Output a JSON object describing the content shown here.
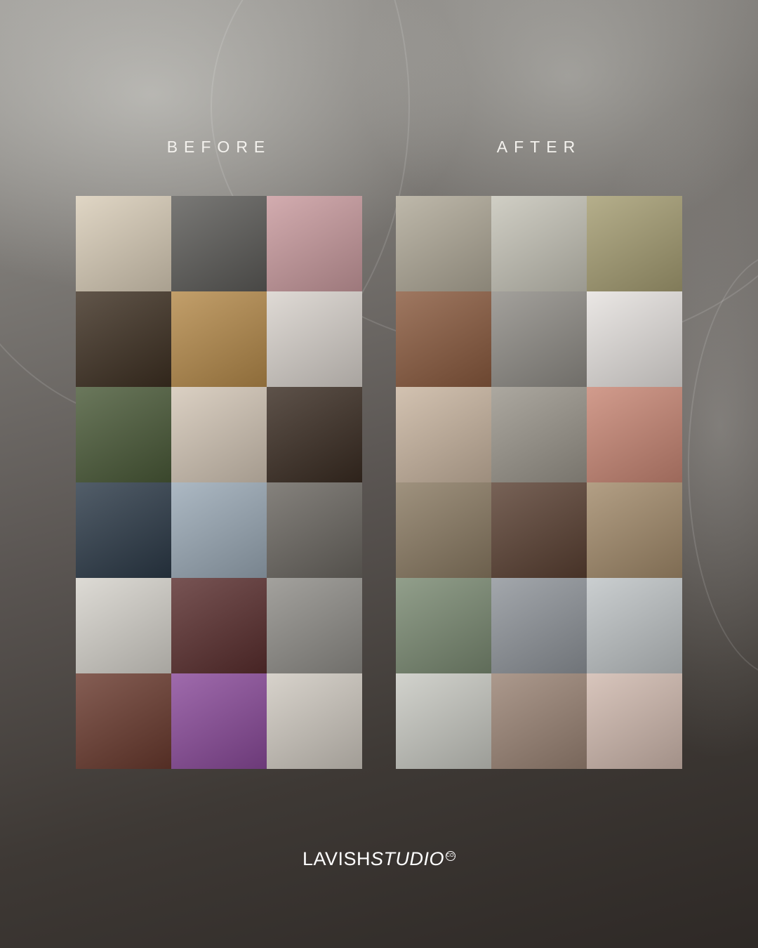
{
  "headings": {
    "before": "BEFORE",
    "after": "AFTER"
  },
  "brand": {
    "part1": "LAVISH",
    "part2": "STUDIO",
    "mark": "CO."
  },
  "before_tiles": [
    {
      "name": "rings-on-lace-photo",
      "color": "#d9cdb8"
    },
    {
      "name": "couple-shadow-photo",
      "color": "#5c5b58"
    },
    {
      "name": "floral-cake-photo",
      "color": "#c99a9e"
    },
    {
      "name": "tiered-cake-night-photo",
      "color": "#3e3022"
    },
    {
      "name": "golden-ballroom-photo",
      "color": "#b58a4a"
    },
    {
      "name": "bouquet-invitation-photo",
      "color": "#d8d2cc"
    },
    {
      "name": "holding-hands-photo",
      "color": "#4a5a38"
    },
    {
      "name": "bride-groom-hearts-photo",
      "color": "#d3c6b6"
    },
    {
      "name": "string-lights-dance-photo",
      "color": "#3a2c22"
    },
    {
      "name": "wedding-car-photo",
      "color": "#2c3a48"
    },
    {
      "name": "lakeside-aisle-photo",
      "color": "#9aa9b6"
    },
    {
      "name": "stairs-couple-photo",
      "color": "#6a6660"
    },
    {
      "name": "arch-ceremony-photo",
      "color": "#d6d3cc"
    },
    {
      "name": "dancing-couple-photo",
      "color": "#5a2e2e"
    },
    {
      "name": "invitation-card-photo",
      "color": "#8f8d88"
    },
    {
      "name": "cake-flowers-photo",
      "color": "#6a3a2e"
    },
    {
      "name": "purple-dance-floor-photo",
      "color": "#8a4a9a"
    },
    {
      "name": "bokeh-rings-photo",
      "color": "#cfc9c0"
    }
  ],
  "after_tiles": [
    {
      "name": "candle-table-photo",
      "color": "#b0a998"
    },
    {
      "name": "vintage-car-couple-photo",
      "color": "#c6c4b8"
    },
    {
      "name": "greenery-initial-photo",
      "color": "#a59d72"
    },
    {
      "name": "dried-flower-cake-photo",
      "color": "#8a5a3e"
    },
    {
      "name": "groom-carrying-bride-photo",
      "color": "#8f8c86"
    },
    {
      "name": "cherry-glasses-photo",
      "color": "#e6e2df"
    },
    {
      "name": "napkin-place-setting-photo",
      "color": "#c9b5a0"
    },
    {
      "name": "running-couple-photo",
      "color": "#9a958b"
    },
    {
      "name": "peach-roses-photo",
      "color": "#c88674"
    },
    {
      "name": "garden-cart-photo",
      "color": "#8a7a62"
    },
    {
      "name": "smiling-couple-photo",
      "color": "#5a4032"
    },
    {
      "name": "banquet-table-photo",
      "color": "#a28a6a"
    },
    {
      "name": "white-chairs-aisle-photo",
      "color": "#7a8a72"
    },
    {
      "name": "road-couple-photo",
      "color": "#8f949a"
    },
    {
      "name": "dessert-stand-photo",
      "color": "#bfc4c6"
    },
    {
      "name": "white-reception-photo",
      "color": "#c8c9c2"
    },
    {
      "name": "bride-embrace-photo",
      "color": "#9a8374"
    },
    {
      "name": "pink-floral-table-photo",
      "color": "#d0b9ae"
    }
  ]
}
